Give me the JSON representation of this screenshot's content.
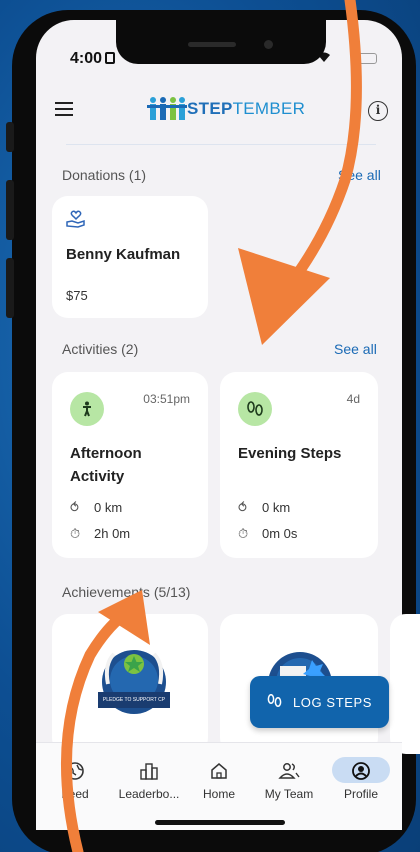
{
  "status_bar": {
    "time": "4:00"
  },
  "header": {
    "logo_step": "STEP",
    "logo_tember": "TEMBER"
  },
  "donations": {
    "title": "Donations (1)",
    "see_all": "See all",
    "items": [
      {
        "name": "Benny Kaufman",
        "amount": "$75"
      }
    ]
  },
  "activities": {
    "title": "Activities (2)",
    "see_all": "See all",
    "items": [
      {
        "time": "03:51pm",
        "title": "Afternoon Activity",
        "distance": "0 km",
        "duration": "2h 0m",
        "icon": "walking-person-icon"
      },
      {
        "time": "4d",
        "title": "Evening Steps",
        "distance": "0 km",
        "duration": "0m 0s",
        "icon": "footsteps-icon"
      }
    ]
  },
  "achievements": {
    "title": "Achievements (5/13)",
    "items": [
      {
        "badge_text": "PLEDGE TO SUPPORT CP"
      },
      {
        "badge_text": ""
      }
    ]
  },
  "log_steps": {
    "label": "LOG STEPS"
  },
  "tabs": [
    {
      "label": "Feed",
      "icon": "globe-icon",
      "active": false
    },
    {
      "label": "Leaderbo...",
      "icon": "podium-icon",
      "active": false
    },
    {
      "label": "Home",
      "icon": "home-icon",
      "active": false
    },
    {
      "label": "My Team",
      "icon": "team-icon",
      "active": false
    },
    {
      "label": "Profile",
      "icon": "profile-icon",
      "active": true
    }
  ],
  "colors": {
    "accent": "#1164ac",
    "arrow": "#f07f3a",
    "activity_badge": "#b7e6a4",
    "background": "#0d4f93"
  }
}
